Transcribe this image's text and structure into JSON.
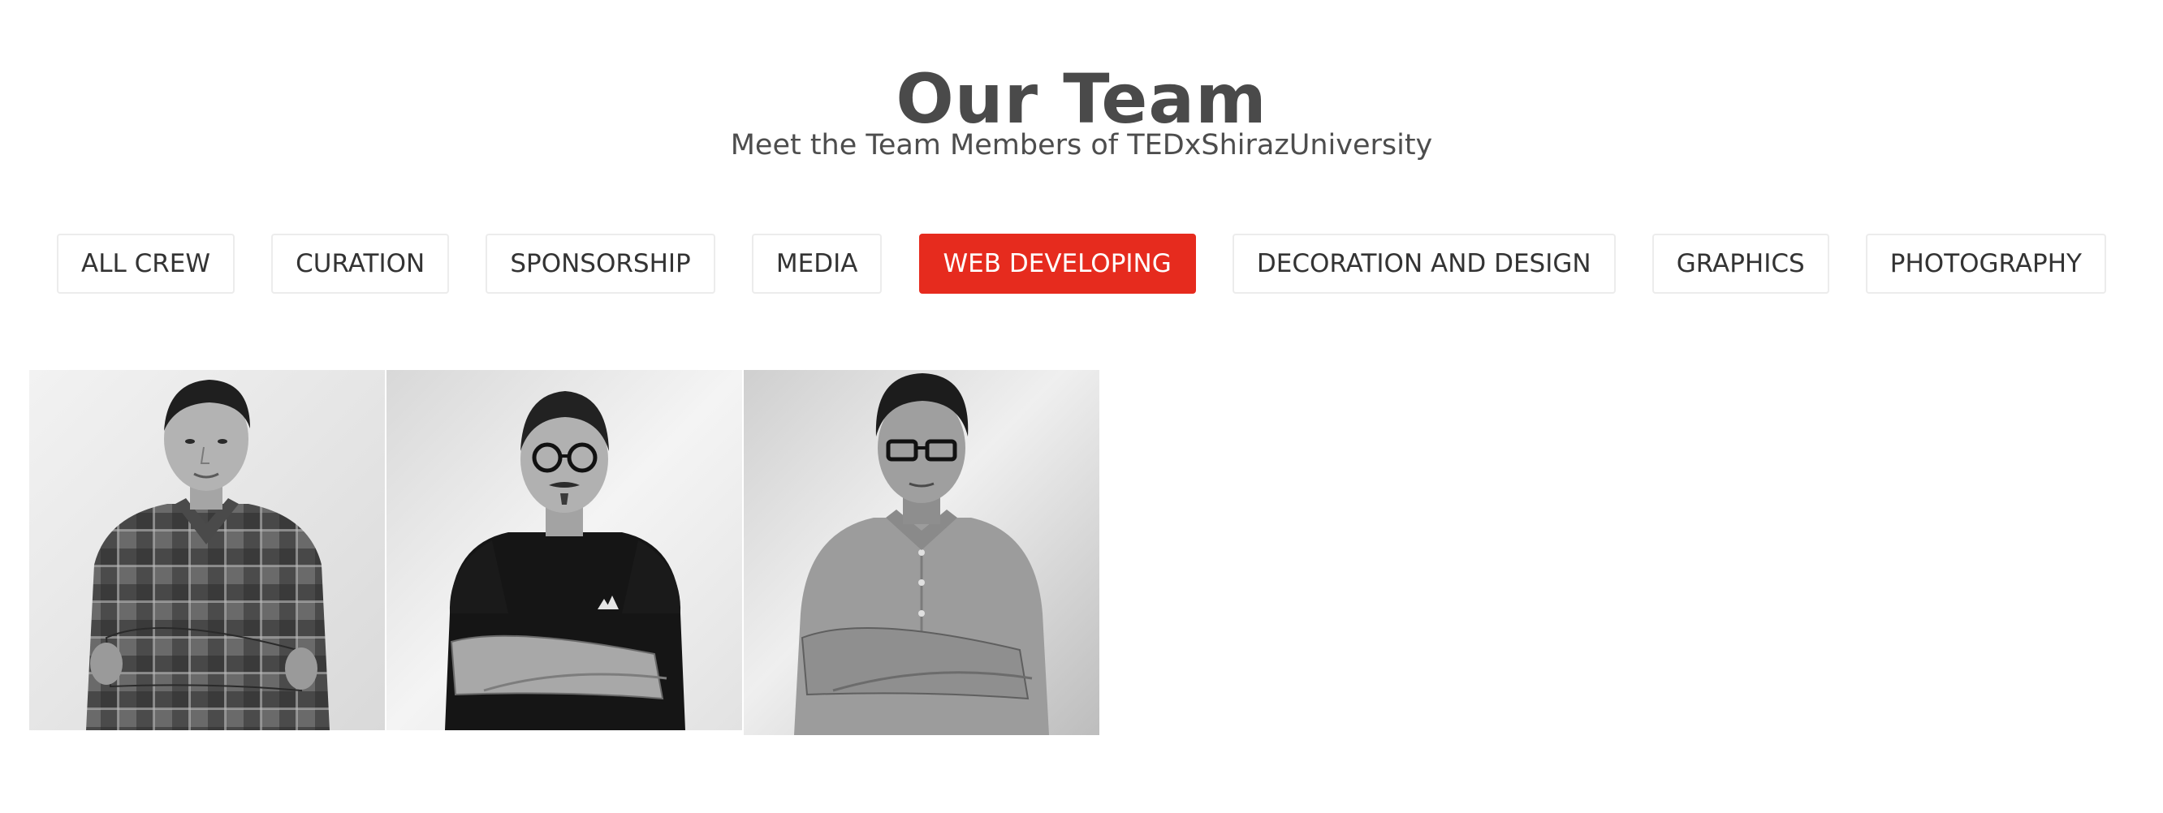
{
  "header": {
    "title": "Our Team",
    "subtitle": "Meet the Team Members of TEDxShirazUniversity"
  },
  "filters": [
    {
      "label": "ALL CREW",
      "active": false
    },
    {
      "label": "CURATION",
      "active": false
    },
    {
      "label": "SPONSORSHIP",
      "active": false
    },
    {
      "label": "MEDIA",
      "active": false
    },
    {
      "label": "WEB DEVELOPING",
      "active": true
    },
    {
      "label": "DECORATION AND DESIGN",
      "active": false
    },
    {
      "label": "GRAPHICS",
      "active": false
    },
    {
      "label": "PHOTOGRAPHY",
      "active": false
    }
  ],
  "colors": {
    "accent": "#e62b1e",
    "text": "#4a4a4a",
    "button_border": "#ececec"
  },
  "members": [
    {
      "photo": "team-member-photo",
      "shirt": "plaid-shirt",
      "glasses": false
    },
    {
      "photo": "team-member-photo",
      "shirt": "black-tshirt",
      "glasses": true
    },
    {
      "photo": "team-member-photo",
      "shirt": "light-button-shirt",
      "glasses": true
    }
  ]
}
